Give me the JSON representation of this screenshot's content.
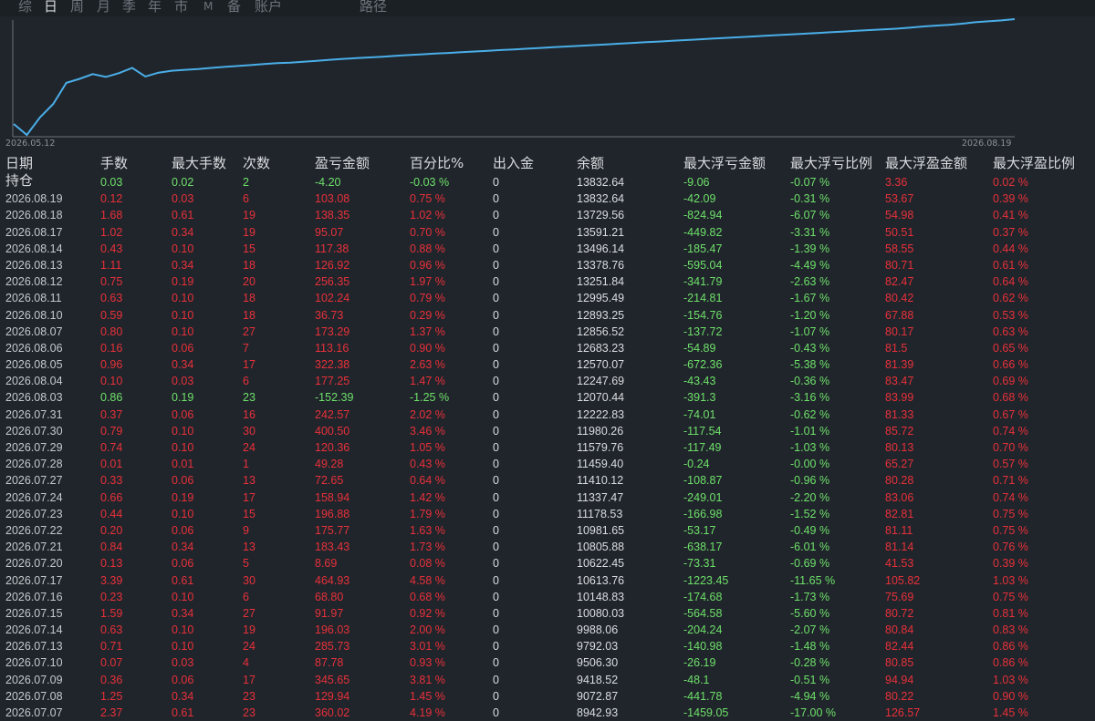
{
  "tabs": [
    {
      "label": "综",
      "active": false
    },
    {
      "label": "日",
      "active": true
    },
    {
      "label": "周",
      "active": false
    },
    {
      "label": "月",
      "active": false
    },
    {
      "label": "季",
      "active": false
    },
    {
      "label": "年",
      "active": false
    },
    {
      "label": "市",
      "active": false
    },
    {
      "label": "M",
      "active": false
    },
    {
      "label": "备",
      "active": false
    },
    {
      "label": "账户",
      "active": false
    },
    {
      "label": "路径",
      "active": false
    }
  ],
  "colors": {
    "background": "#20252b",
    "line": "#4aaee8",
    "red": "#e8303a",
    "green": "#6ee06a",
    "white": "#d9dde1"
  },
  "chart_data": {
    "type": "line",
    "x_start_label": "2026.05.12",
    "x_end_label": "2026.08.19",
    "grid": false,
    "series": [
      {
        "values": [
          9420,
          8960,
          9700,
          10260,
          11150,
          11320,
          11520,
          11400,
          11560,
          11780,
          11420,
          11580,
          11660,
          11700,
          11730,
          11780,
          11820,
          11860,
          11900,
          11940,
          11980,
          12000,
          12040,
          12080,
          12120,
          12160,
          12190,
          12220,
          12250,
          12290,
          12320,
          12350,
          12380,
          12410,
          12440,
          12470,
          12500,
          12530,
          12560,
          12590,
          12620,
          12650,
          12680,
          12710,
          12740,
          12770,
          12800,
          12830,
          12860,
          12890,
          12920,
          12950,
          12980,
          13010,
          13040,
          13070,
          13100,
          13130,
          13160,
          13190,
          13220,
          13250,
          13280,
          13310,
          13340,
          13370,
          13400,
          13430,
          13470,
          13520,
          13560,
          13590,
          13640,
          13700,
          13740,
          13780,
          13832
        ]
      }
    ]
  },
  "headers": [
    "日期",
    "手数",
    "最大手数",
    "次数",
    "盈亏金额",
    "百分比%",
    "出入金",
    "余额",
    "最大浮亏金额",
    "最大浮亏比例",
    "最大浮盈金额",
    "最大浮盈比例"
  ],
  "position_row": {
    "label": "持仓",
    "cells": [
      "0.03",
      "0.02",
      "2",
      "-4.20",
      "-0.03 %",
      "0",
      "13832.64",
      "-9.06",
      "-0.07 %",
      "3.36",
      "0.02 %"
    ],
    "kind": "green"
  },
  "rows": [
    {
      "cells": [
        "2026.08.19",
        "0.12",
        "0.03",
        "6",
        "103.08",
        "0.75 %",
        "0",
        "13832.64",
        "-42.09",
        "-0.31 %",
        "53.67",
        "0.39 %"
      ],
      "kind": "red"
    },
    {
      "cells": [
        "2026.08.18",
        "1.68",
        "0.61",
        "19",
        "138.35",
        "1.02 %",
        "0",
        "13729.56",
        "-824.94",
        "-6.07 %",
        "54.98",
        "0.41 %"
      ],
      "kind": "red"
    },
    {
      "cells": [
        "2026.08.17",
        "1.02",
        "0.34",
        "19",
        "95.07",
        "0.70 %",
        "0",
        "13591.21",
        "-449.82",
        "-3.31 %",
        "50.51",
        "0.37 %"
      ],
      "kind": "red"
    },
    {
      "cells": [
        "2026.08.14",
        "0.43",
        "0.10",
        "15",
        "117.38",
        "0.88 %",
        "0",
        "13496.14",
        "-185.47",
        "-1.39 %",
        "58.55",
        "0.44 %"
      ],
      "kind": "red"
    },
    {
      "cells": [
        "2026.08.13",
        "1.11",
        "0.34",
        "18",
        "126.92",
        "0.96 %",
        "0",
        "13378.76",
        "-595.04",
        "-4.49 %",
        "80.71",
        "0.61 %"
      ],
      "kind": "red"
    },
    {
      "cells": [
        "2026.08.12",
        "0.75",
        "0.19",
        "20",
        "256.35",
        "1.97 %",
        "0",
        "13251.84",
        "-341.79",
        "-2.63 %",
        "82.47",
        "0.64 %"
      ],
      "kind": "red"
    },
    {
      "cells": [
        "2026.08.11",
        "0.63",
        "0.10",
        "18",
        "102.24",
        "0.79 %",
        "0",
        "12995.49",
        "-214.81",
        "-1.67 %",
        "80.42",
        "0.62 %"
      ],
      "kind": "red"
    },
    {
      "cells": [
        "2026.08.10",
        "0.59",
        "0.10",
        "18",
        "36.73",
        "0.29 %",
        "0",
        "12893.25",
        "-154.76",
        "-1.20 %",
        "67.88",
        "0.53 %"
      ],
      "kind": "red"
    },
    {
      "cells": [
        "2026.08.07",
        "0.80",
        "0.10",
        "27",
        "173.29",
        "1.37 %",
        "0",
        "12856.52",
        "-137.72",
        "-1.07 %",
        "80.17",
        "0.63 %"
      ],
      "kind": "red"
    },
    {
      "cells": [
        "2026.08.06",
        "0.16",
        "0.06",
        "7",
        "113.16",
        "0.90 %",
        "0",
        "12683.23",
        "-54.89",
        "-0.43 %",
        "81.5",
        "0.65 %"
      ],
      "kind": "red"
    },
    {
      "cells": [
        "2026.08.05",
        "0.96",
        "0.34",
        "17",
        "322.38",
        "2.63 %",
        "0",
        "12570.07",
        "-672.36",
        "-5.38 %",
        "81.39",
        "0.66 %"
      ],
      "kind": "red"
    },
    {
      "cells": [
        "2026.08.04",
        "0.10",
        "0.03",
        "6",
        "177.25",
        "1.47 %",
        "0",
        "12247.69",
        "-43.43",
        "-0.36 %",
        "83.47",
        "0.69 %"
      ],
      "kind": "red"
    },
    {
      "cells": [
        "2026.08.03",
        "0.86",
        "0.19",
        "23",
        "-152.39",
        "-1.25 %",
        "0",
        "12070.44",
        "-391.3",
        "-3.16 %",
        "83.99",
        "0.68 %"
      ],
      "kind": "green"
    },
    {
      "cells": [
        "2026.07.31",
        "0.37",
        "0.06",
        "16",
        "242.57",
        "2.02 %",
        "0",
        "12222.83",
        "-74.01",
        "-0.62 %",
        "81.33",
        "0.67 %"
      ],
      "kind": "red"
    },
    {
      "cells": [
        "2026.07.30",
        "0.79",
        "0.10",
        "30",
        "400.50",
        "3.46 %",
        "0",
        "11980.26",
        "-117.54",
        "-1.01 %",
        "85.72",
        "0.74 %"
      ],
      "kind": "red"
    },
    {
      "cells": [
        "2026.07.29",
        "0.74",
        "0.10",
        "24",
        "120.36",
        "1.05 %",
        "0",
        "11579.76",
        "-117.49",
        "-1.03 %",
        "80.13",
        "0.70 %"
      ],
      "kind": "red"
    },
    {
      "cells": [
        "2026.07.28",
        "0.01",
        "0.01",
        "1",
        "49.28",
        "0.43 %",
        "0",
        "11459.40",
        "-0.24",
        "-0.00 %",
        "65.27",
        "0.57 %"
      ],
      "kind": "red"
    },
    {
      "cells": [
        "2026.07.27",
        "0.33",
        "0.06",
        "13",
        "72.65",
        "0.64 %",
        "0",
        "11410.12",
        "-108.87",
        "-0.96 %",
        "80.28",
        "0.71 %"
      ],
      "kind": "red"
    },
    {
      "cells": [
        "2026.07.24",
        "0.66",
        "0.19",
        "17",
        "158.94",
        "1.42 %",
        "0",
        "11337.47",
        "-249.01",
        "-2.20 %",
        "83.06",
        "0.74 %"
      ],
      "kind": "red"
    },
    {
      "cells": [
        "2026.07.23",
        "0.44",
        "0.10",
        "15",
        "196.88",
        "1.79 %",
        "0",
        "11178.53",
        "-166.98",
        "-1.52 %",
        "82.81",
        "0.75 %"
      ],
      "kind": "red"
    },
    {
      "cells": [
        "2026.07.22",
        "0.20",
        "0.06",
        "9",
        "175.77",
        "1.63 %",
        "0",
        "10981.65",
        "-53.17",
        "-0.49 %",
        "81.11",
        "0.75 %"
      ],
      "kind": "red"
    },
    {
      "cells": [
        "2026.07.21",
        "0.84",
        "0.34",
        "13",
        "183.43",
        "1.73 %",
        "0",
        "10805.88",
        "-638.17",
        "-6.01 %",
        "81.14",
        "0.76 %"
      ],
      "kind": "red"
    },
    {
      "cells": [
        "2026.07.20",
        "0.13",
        "0.06",
        "5",
        "8.69",
        "0.08 %",
        "0",
        "10622.45",
        "-73.31",
        "-0.69 %",
        "41.53",
        "0.39 %"
      ],
      "kind": "red"
    },
    {
      "cells": [
        "2026.07.17",
        "3.39",
        "0.61",
        "30",
        "464.93",
        "4.58 %",
        "0",
        "10613.76",
        "-1223.45",
        "-11.65 %",
        "105.82",
        "1.03 %"
      ],
      "kind": "red"
    },
    {
      "cells": [
        "2026.07.16",
        "0.23",
        "0.10",
        "6",
        "68.80",
        "0.68 %",
        "0",
        "10148.83",
        "-174.68",
        "-1.73 %",
        "75.69",
        "0.75 %"
      ],
      "kind": "red"
    },
    {
      "cells": [
        "2026.07.15",
        "1.59",
        "0.34",
        "27",
        "91.97",
        "0.92 %",
        "0",
        "10080.03",
        "-564.58",
        "-5.60 %",
        "80.72",
        "0.81 %"
      ],
      "kind": "red"
    },
    {
      "cells": [
        "2026.07.14",
        "0.63",
        "0.10",
        "19",
        "196.03",
        "2.00 %",
        "0",
        "9988.06",
        "-204.24",
        "-2.07 %",
        "80.84",
        "0.83 %"
      ],
      "kind": "red"
    },
    {
      "cells": [
        "2026.07.13",
        "0.71",
        "0.10",
        "24",
        "285.73",
        "3.01 %",
        "0",
        "9792.03",
        "-140.98",
        "-1.48 %",
        "82.44",
        "0.86 %"
      ],
      "kind": "red"
    },
    {
      "cells": [
        "2026.07.10",
        "0.07",
        "0.03",
        "4",
        "87.78",
        "0.93 %",
        "0",
        "9506.30",
        "-26.19",
        "-0.28 %",
        "80.85",
        "0.86 %"
      ],
      "kind": "red"
    },
    {
      "cells": [
        "2026.07.09",
        "0.36",
        "0.06",
        "17",
        "345.65",
        "3.81 %",
        "0",
        "9418.52",
        "-48.1",
        "-0.51 %",
        "94.94",
        "1.03 %"
      ],
      "kind": "red"
    },
    {
      "cells": [
        "2026.07.08",
        "1.25",
        "0.34",
        "23",
        "129.94",
        "1.45 %",
        "0",
        "9072.87",
        "-441.78",
        "-4.94 %",
        "80.22",
        "0.90 %"
      ],
      "kind": "red"
    },
    {
      "cells": [
        "2026.07.07",
        "2.37",
        "0.61",
        "23",
        "360.02",
        "4.19 %",
        "0",
        "8942.93",
        "-1459.05",
        "-17.00 %",
        "126.57",
        "1.45 %"
      ],
      "kind": "red"
    }
  ]
}
